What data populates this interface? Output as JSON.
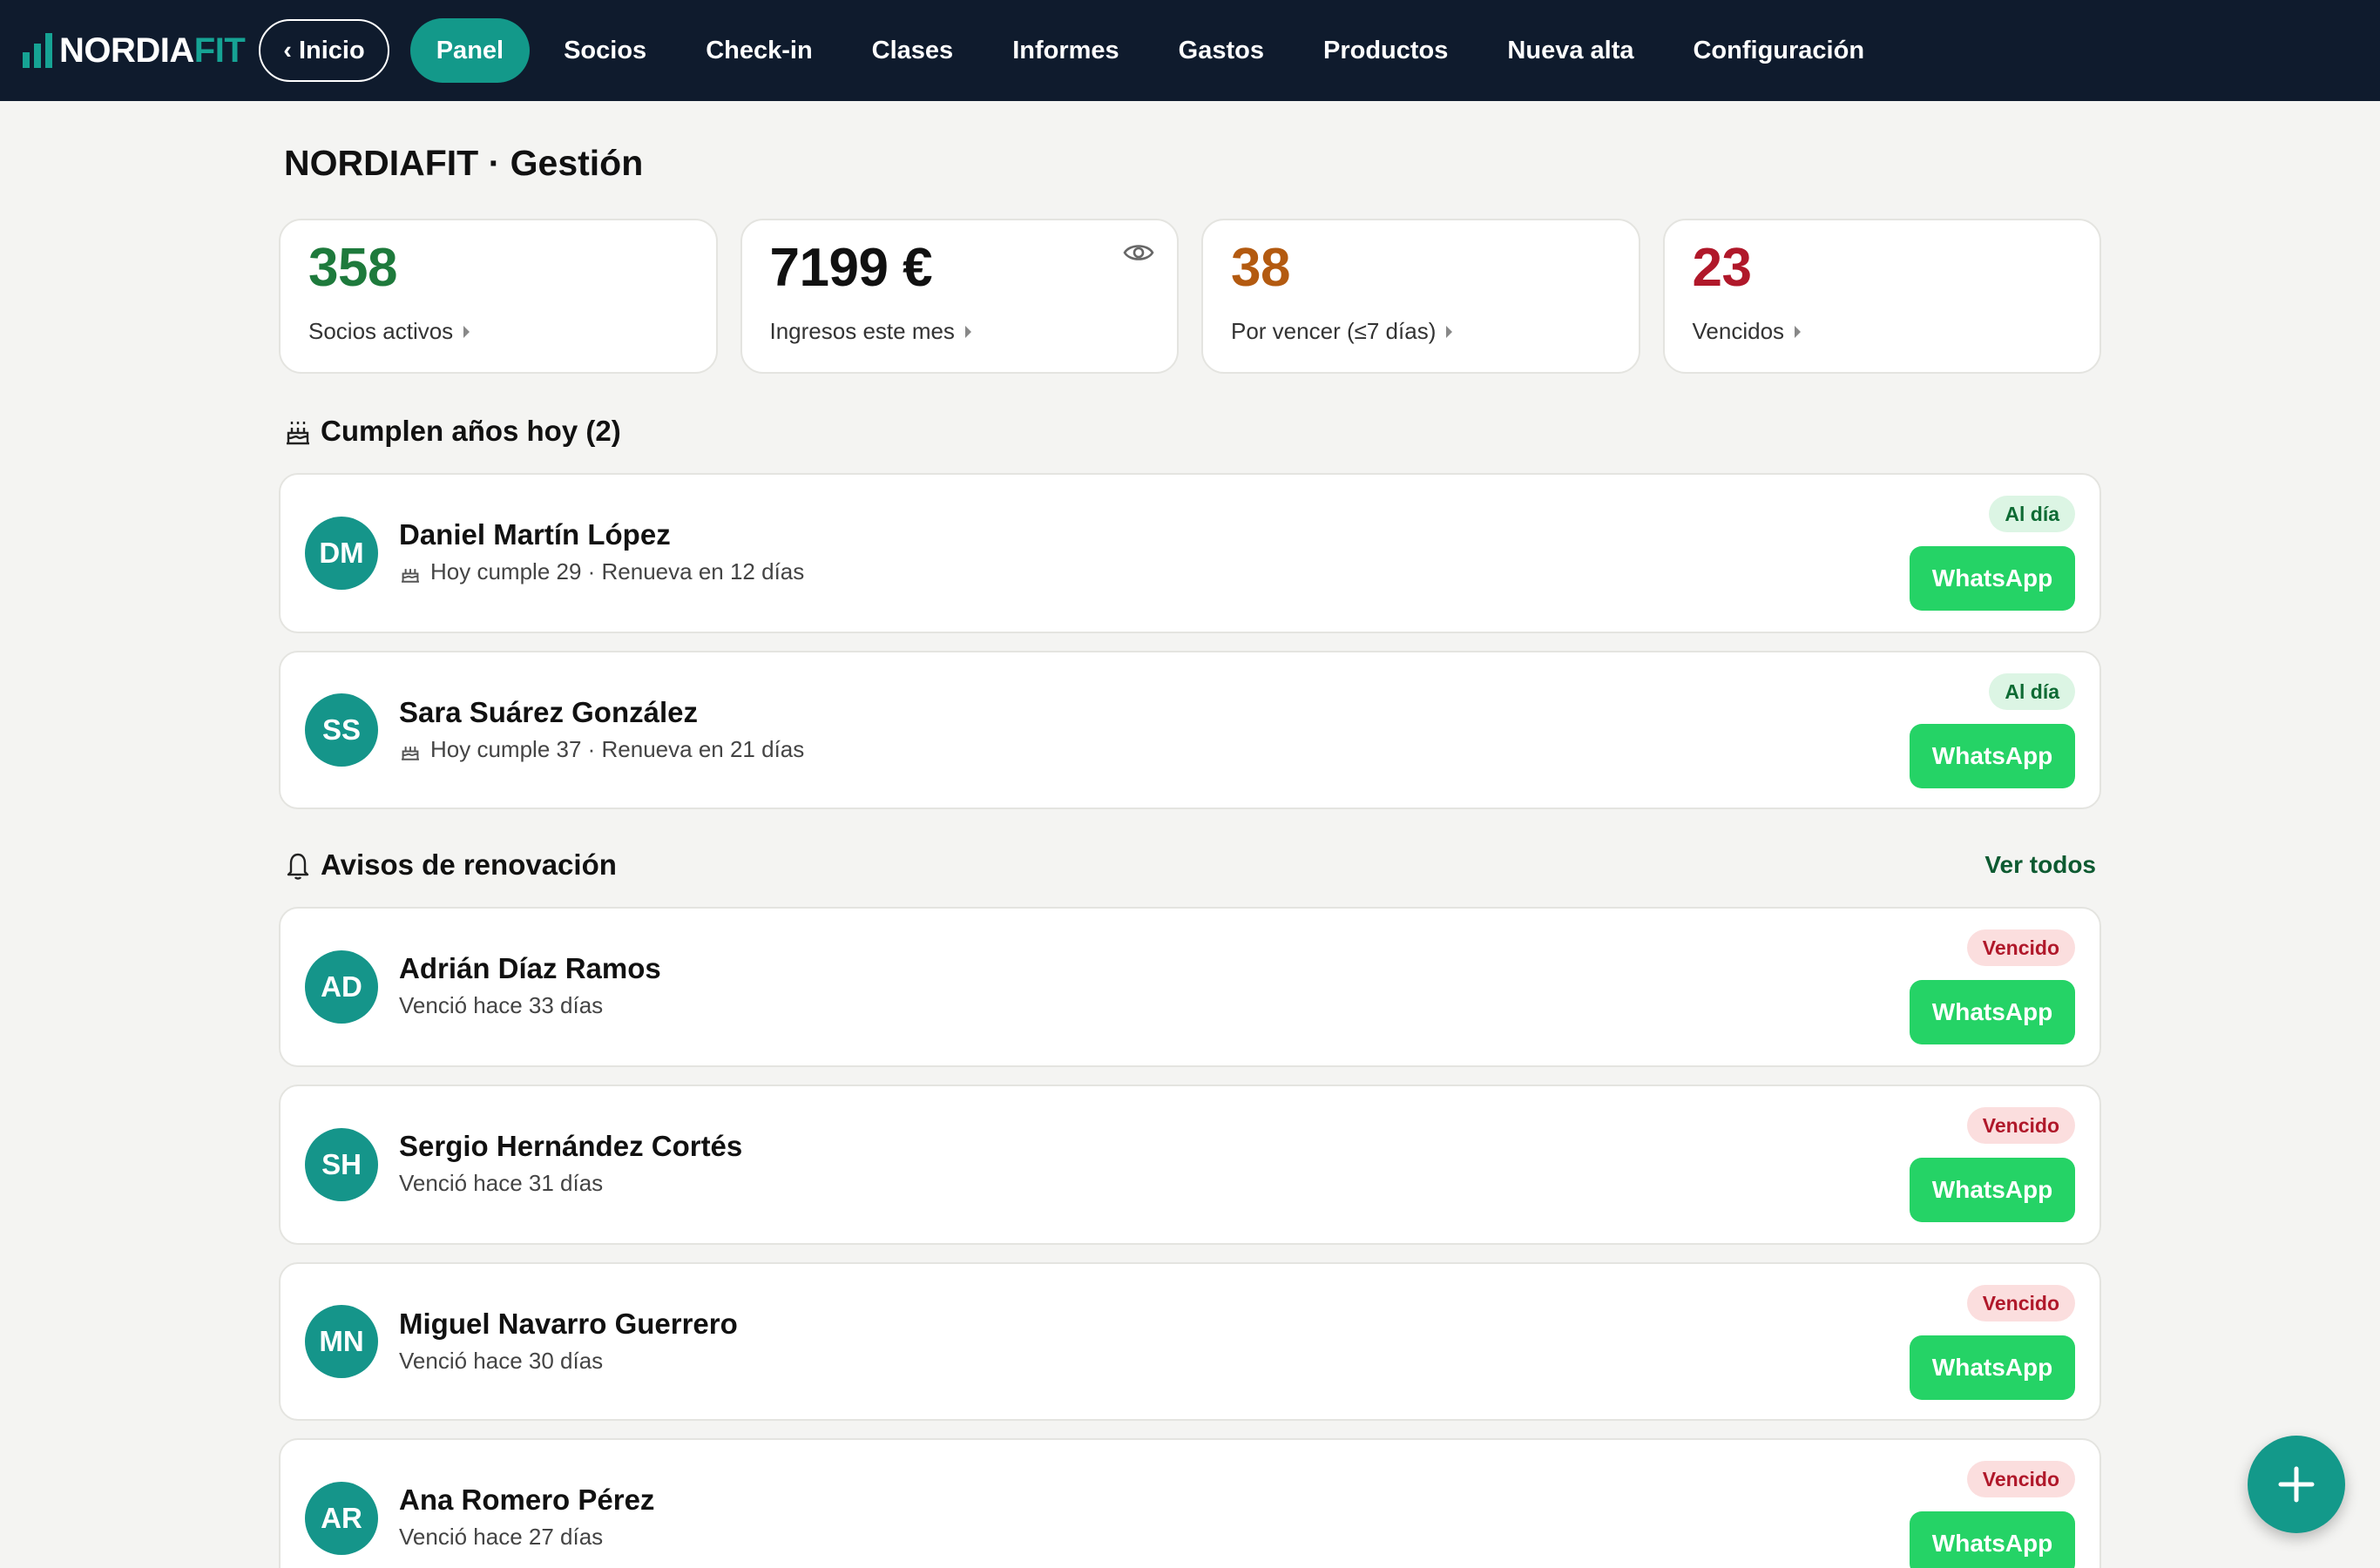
{
  "app": {
    "logo_main": "NORDIA",
    "logo_accent": "FIT"
  },
  "nav": {
    "back_label": "‹ Inicio",
    "items": [
      "Panel",
      "Socios",
      "Check-in",
      "Clases",
      "Informes",
      "Gastos",
      "Productos",
      "Nueva alta",
      "Configuración"
    ],
    "active": "Panel"
  },
  "page": {
    "title": "NORDIAFIT · Gestión"
  },
  "stats": [
    {
      "value": "358",
      "label": "Socios activos",
      "color": "#1e7a3c"
    },
    {
      "value": "7199 €",
      "label": "Ingresos este mes",
      "color": "#111111",
      "icon": "eye-icon"
    },
    {
      "value": "38",
      "label": "Por vencer (≤7 días)",
      "color": "#b35a10"
    },
    {
      "value": "23",
      "label": "Vencidos",
      "color": "#b0182a"
    }
  ],
  "birthdays": {
    "title": "Cumplen años hoy (2)",
    "icon": "cake-icon",
    "items": [
      {
        "initials": "DM",
        "name": "Daniel Martín López",
        "detail": "Hoy cumple 29 · Renueva en 12 días",
        "status": "Al día",
        "action": "WhatsApp"
      },
      {
        "initials": "SS",
        "name": "Sara Suárez González",
        "detail": "Hoy cumple 37 · Renueva en 21 días",
        "status": "Al día",
        "action": "WhatsApp"
      }
    ]
  },
  "renewals": {
    "title": "Avisos de renovación",
    "icon": "bell-icon",
    "see_all": "Ver todos",
    "items": [
      {
        "initials": "AD",
        "name": "Adrián Díaz Ramos",
        "detail": "Venció hace 33 días",
        "status": "Vencido",
        "action": "WhatsApp"
      },
      {
        "initials": "SH",
        "name": "Sergio Hernández Cortés",
        "detail": "Venció hace 31 días",
        "status": "Vencido",
        "action": "WhatsApp"
      },
      {
        "initials": "MN",
        "name": "Miguel Navarro Guerrero",
        "detail": "Venció hace 30 días",
        "status": "Vencido",
        "action": "WhatsApp"
      },
      {
        "initials": "AR",
        "name": "Ana Romero Pérez",
        "detail": "Venció hace 27 días",
        "status": "Vencido",
        "action": "WhatsApp"
      }
    ]
  },
  "colors": {
    "nav_bg": "#0f1b2d",
    "accent": "#13998a",
    "whatsapp": "#25d366"
  }
}
